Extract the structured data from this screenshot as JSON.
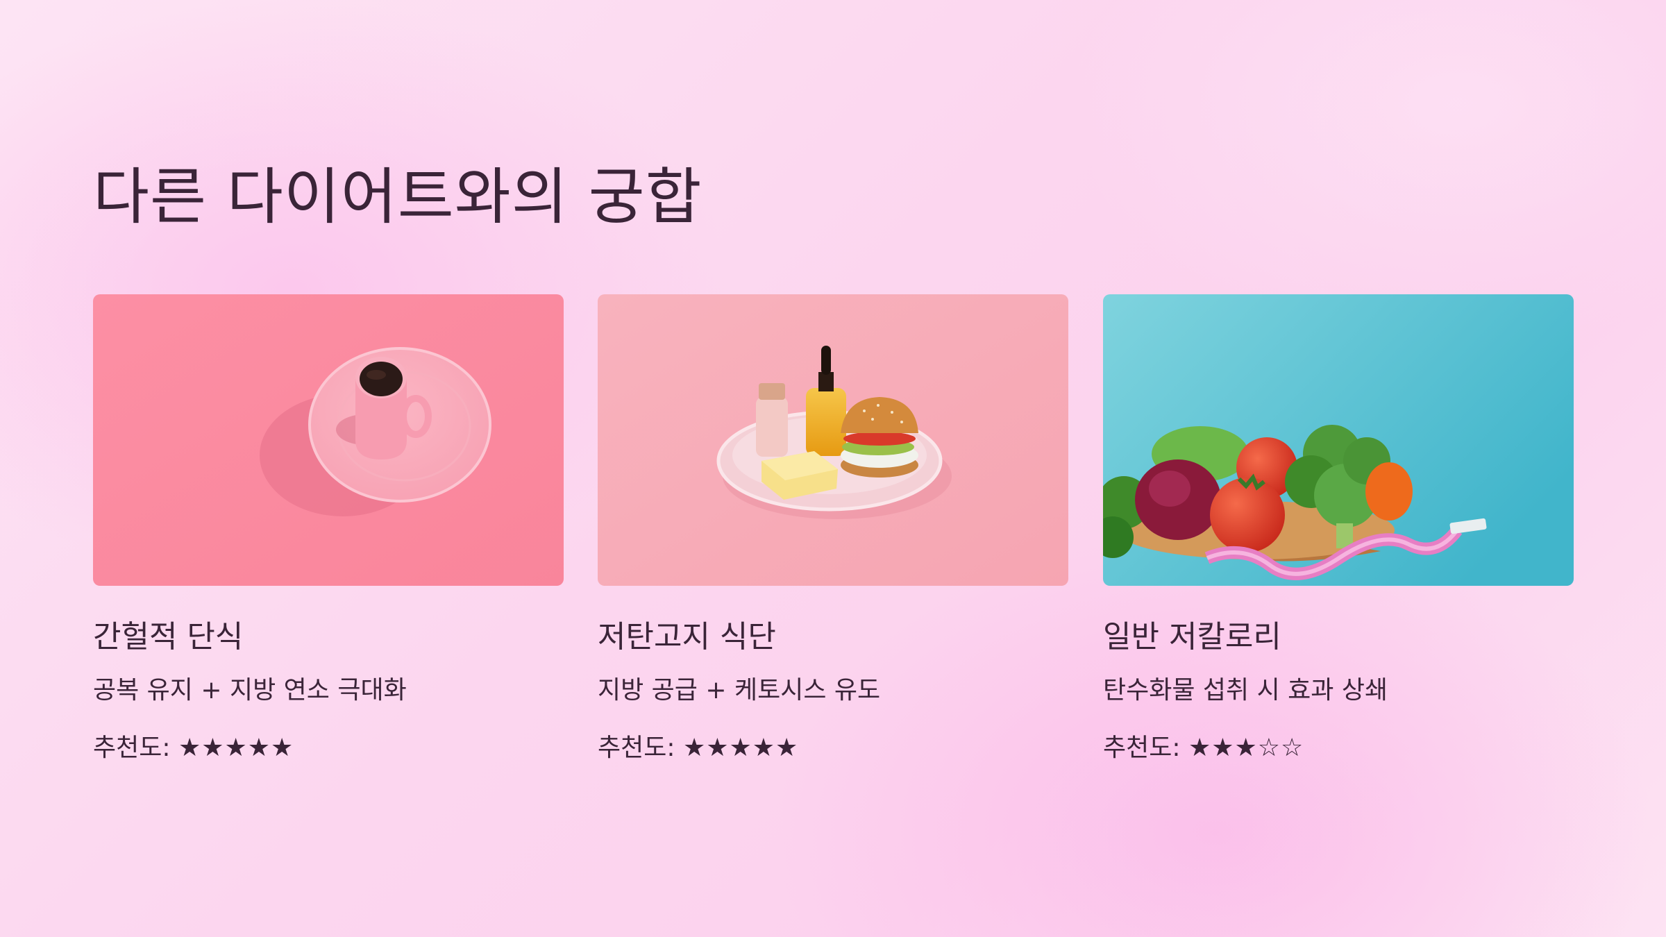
{
  "slide": {
    "title": "다른 다이어트와의 궁합"
  },
  "cards": [
    {
      "title": "간헐적 단식",
      "description": "공복 유지 + 지방 연소 극대화",
      "rating_label": "추천도:",
      "rating_stars": "★★★★★",
      "rating": 5,
      "rating_max": 5,
      "image": "black-coffee-cup-on-pink-plate",
      "background_color": "#fc8da0"
    },
    {
      "title": "저탄고지 식단",
      "description": "지방 공급 + 케토시스 유도",
      "rating_label": "추천도:",
      "rating_stars": "★★★★★",
      "rating": 5,
      "rating_max": 5,
      "image": "burger-butter-oil-bottles-on-plate",
      "background_color": "#f7aab6"
    },
    {
      "title": "일반 저칼로리",
      "description": "탄수화물 섭취 시 효과 상쇄",
      "rating_label": "추천도:",
      "rating_stars": "★★★☆☆",
      "rating": 3,
      "rating_max": 5,
      "image": "vegetables-bowl-with-measuring-tape",
      "background_color": "#5cc4d4"
    }
  ],
  "colors": {
    "text": "#3a2438",
    "background": "#fcd6ef"
  }
}
